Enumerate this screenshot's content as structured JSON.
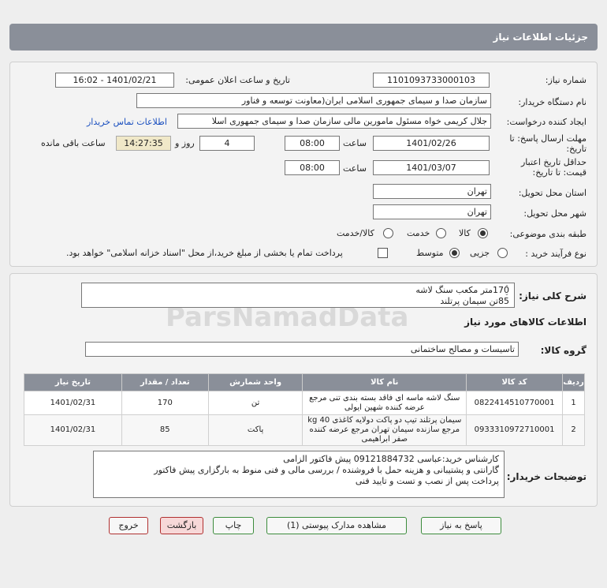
{
  "header": {
    "title": "جزئیات اطلاعات نیاز"
  },
  "form": {
    "need_number_label": "شماره نیاز:",
    "need_number": "1101093733000103",
    "announce_label": "تاریخ و ساعت اعلان عمومی:",
    "announce_value": "1401/02/21 - 16:02",
    "buyer_org_label": "نام دستگاه خریدار:",
    "buyer_org": "سازمان صدا و سیمای جمهوری اسلامی ایران(معاونت توسعه و فناور",
    "creator_label": "ایجاد کننده درخواست:",
    "creator": "جلال کریمی خواه مسئول مامورین مالی  سازمان صدا و سیمای جمهوری اسلا",
    "contact_link": "اطلاعات تماس خریدار",
    "deadline_label_1": "مهلت ارسال پاسخ: تا",
    "deadline_label_2": "تاریخ:",
    "deadline_date": "1401/02/26",
    "time_label": "ساعت",
    "deadline_time": "08:00",
    "days_value": "4",
    "days_label": "روز و",
    "remaining_time": "14:27:35",
    "remaining_label": "ساعت باقی مانده",
    "validity_label_1": "حداقل تاریخ اعتبار",
    "validity_label_2": "قیمت: تا تاریخ:",
    "validity_date": "1401/03/07",
    "validity_time": "08:00",
    "province_label": "استان محل تحویل:",
    "province": "تهران",
    "city_label": "شهر محل تحویل:",
    "city": "تهران",
    "category_label": "طبقه بندی موضوعی:",
    "category_options": [
      "کالا",
      "خدمت",
      "کالا/خدمت"
    ],
    "process_label": "نوع فرآیند خرید :",
    "process_options": [
      "جزیی",
      "متوسط"
    ],
    "payment_note": "پرداخت تمام یا بخشی از مبلغ خرید،از محل \"اسناد خزانه اسلامی\" خواهد بود."
  },
  "summary": {
    "label": "شرح کلی نیاز:",
    "line1": "170متر مکعب سنگ لاشه",
    "line2": "85تن سیمان پرتلند"
  },
  "goods": {
    "section_title": "اطلاعات کالاهای مورد نیاز",
    "group_label": "گروه کالا:",
    "group_value": "تاسیسات و مصالح ساختمانی",
    "columns": [
      "ردیف",
      "کد کالا",
      "نام کالا",
      "واحد شمارش",
      "تعداد / مقدار",
      "تاریخ نیاز"
    ],
    "rows": [
      [
        "1",
        "0822414510770001",
        "سنگ لاشه ماسه ای فاقد بسته بندی تنی مرجع عرضه کننده شهین ایولی",
        "تن",
        "170",
        "1401/02/31"
      ],
      [
        "2",
        "0933310972710001",
        "سیمان پرتلند تیپ دو پاکت دولایه کاغذی 40 kg مرجع سازنده سیمان تهران مرجع عرضه کننده صفر ابراهیمی",
        "پاکت",
        "85",
        "1401/02/31"
      ]
    ]
  },
  "buyer_notes": {
    "label": "توضیحات خریدار:",
    "line1": "کارشناس خرید:عباسی 09121884732  پیش فاکتور الزامی",
    "line2": "گارانتی و پشتیبانی و هزینه حمل با فروشنده / بررسی مالی و فنی منوط به بارگزاری پیش فاکتور",
    "line3": "پرداخت پس از نصب و تست و تایید فنی"
  },
  "buttons": {
    "reply": "پاسخ به نیاز",
    "docs": "مشاهده مدارک پیوستی (1)",
    "print": "چاپ",
    "back": "بازگشت",
    "exit": "خروج"
  },
  "colors": {
    "header_bg": "#8a8f99",
    "link": "#1a4fbf",
    "highlight": "#f0e8c8"
  }
}
